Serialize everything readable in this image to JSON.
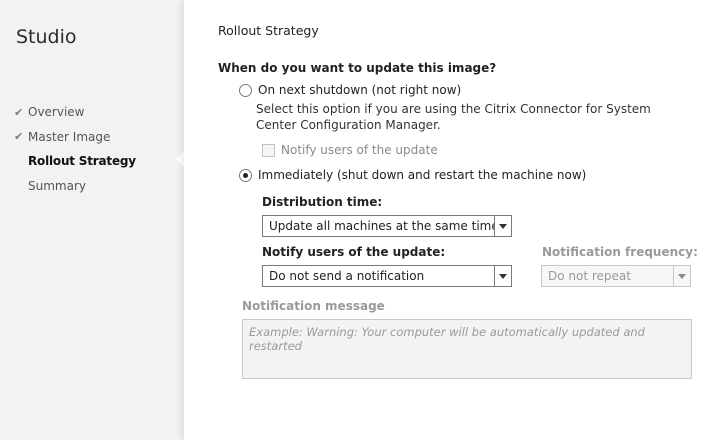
{
  "sidebar": {
    "app_title": "Studio",
    "items": [
      {
        "label": "Overview",
        "completed": true,
        "active": false
      },
      {
        "label": "Master Image",
        "completed": true,
        "active": false
      },
      {
        "label": "Rollout Strategy",
        "completed": false,
        "active": true
      },
      {
        "label": "Summary",
        "completed": false,
        "active": false
      }
    ]
  },
  "main": {
    "title": "Rollout Strategy",
    "question": "When do you want to update this image?",
    "option_next_shutdown": {
      "label": "On next shutdown (not right now)",
      "description": "Select this option if you are using the Citrix Connector for System Center Configuration Manager.",
      "selected": false,
      "notify_checkbox_label": "Notify users of the update",
      "notify_checked": false
    },
    "option_immediately": {
      "label": "Immediately (shut down and restart the machine now)",
      "selected": true
    },
    "distribution_time": {
      "label": "Distribution time:",
      "value": "Update all machines at the same time"
    },
    "notify_users": {
      "label": "Notify users of the update:",
      "value": "Do not send a notification"
    },
    "notification_frequency": {
      "label": "Notification frequency:",
      "value": "Do not repeat",
      "disabled": true
    },
    "notification_message": {
      "label": "Notification message",
      "placeholder": "Example:  Warning: Your computer will be automatically updated and restarted"
    }
  }
}
